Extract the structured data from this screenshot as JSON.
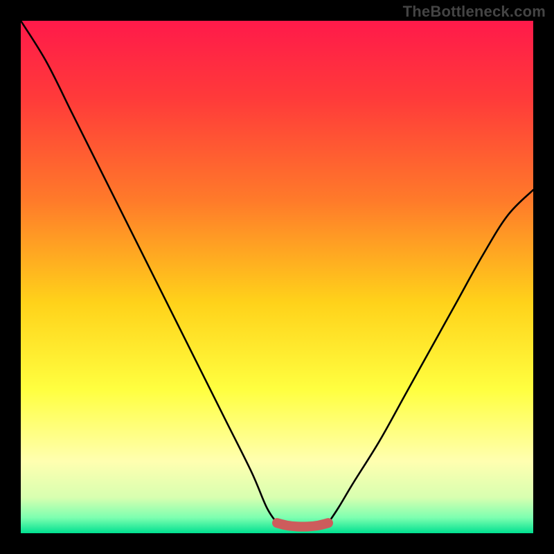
{
  "watermark": "TheBottleneck.com",
  "chart_data": {
    "type": "line",
    "title": "",
    "xlabel": "",
    "ylabel": "",
    "xlim": [
      0,
      100
    ],
    "ylim": [
      0,
      100
    ],
    "series": [
      {
        "name": "curve-left",
        "x": [
          0,
          5,
          10,
          15,
          20,
          25,
          30,
          35,
          40,
          45,
          48,
          50
        ],
        "y": [
          100,
          92,
          82,
          72,
          62,
          52,
          42,
          32,
          22,
          12,
          5,
          2
        ]
      },
      {
        "name": "curve-right",
        "x": [
          60,
          62,
          65,
          70,
          75,
          80,
          85,
          90,
          95,
          100
        ],
        "y": [
          2,
          5,
          10,
          18,
          27,
          36,
          45,
          54,
          62,
          67
        ]
      },
      {
        "name": "flat-region",
        "x": [
          50,
          52,
          54,
          56,
          58,
          60
        ],
        "y": [
          2,
          1.5,
          1.3,
          1.3,
          1.5,
          2
        ],
        "color": "#cd5c5c"
      }
    ],
    "gradient_stops": [
      {
        "offset": 0.0,
        "color": "#ff1a4a"
      },
      {
        "offset": 0.15,
        "color": "#ff3a3a"
      },
      {
        "offset": 0.35,
        "color": "#ff7a2a"
      },
      {
        "offset": 0.55,
        "color": "#ffd21a"
      },
      {
        "offset": 0.72,
        "color": "#ffff40"
      },
      {
        "offset": 0.86,
        "color": "#ffffb0"
      },
      {
        "offset": 0.93,
        "color": "#d8ffb0"
      },
      {
        "offset": 0.97,
        "color": "#7cffb0"
      },
      {
        "offset": 1.0,
        "color": "#00e090"
      }
    ]
  }
}
